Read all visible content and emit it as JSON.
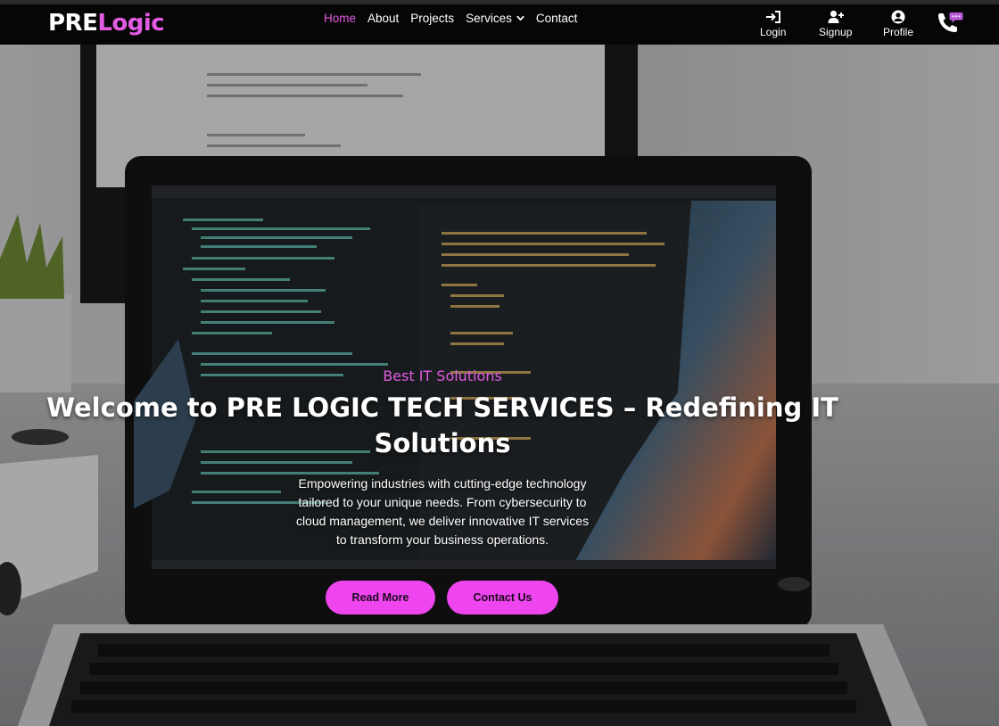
{
  "brand": {
    "part1": "PRE",
    "part2": "Logic"
  },
  "nav": {
    "links": [
      {
        "label": "Home",
        "active": true
      },
      {
        "label": "About"
      },
      {
        "label": "Projects"
      },
      {
        "label": "Services",
        "dropdown": true
      },
      {
        "label": "Contact"
      }
    ],
    "user": {
      "login": "Login",
      "signup": "Signup",
      "profile": "Profile"
    }
  },
  "hero": {
    "eyebrow": "Best IT Solutions",
    "headline": "Welcome to PRE LOGIC TECH SERVICES – Redefining IT Solutions",
    "lead": "Empowering industries with cutting-edge technology tailored to your unique needs. From cybersecurity to cloud management, we deliver innovative IT services to transform your business operations.",
    "buttons": {
      "read_more": "Read More",
      "contact_us": "Contact Us"
    }
  },
  "colors": {
    "accent": "#e25be2",
    "button": "#ef45ef",
    "nav_bg": "#060606"
  },
  "icons": [
    "login-icon",
    "signup-icon",
    "profile-icon",
    "phone-chat-icon",
    "chevron-down-icon"
  ]
}
